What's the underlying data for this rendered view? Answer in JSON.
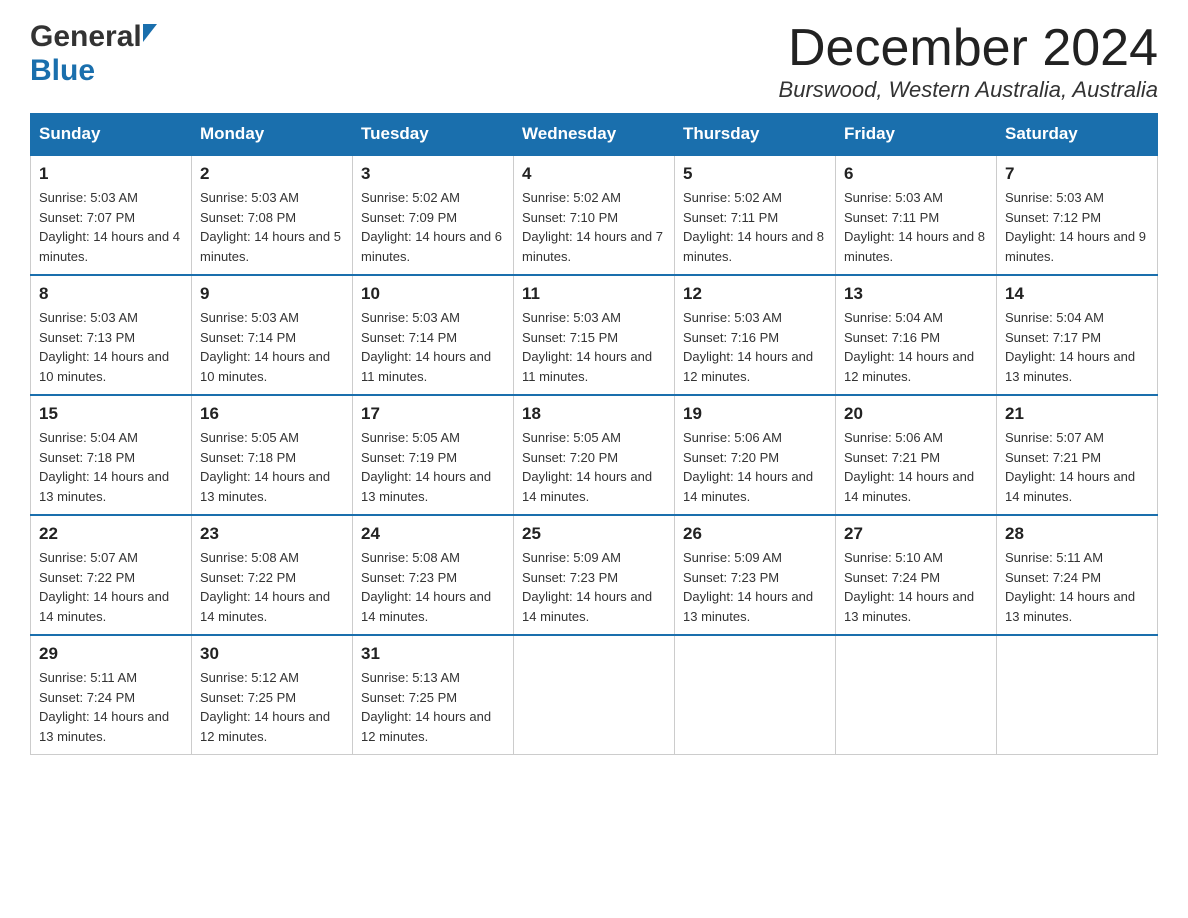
{
  "logo": {
    "general": "General",
    "blue": "Blue"
  },
  "header": {
    "title": "December 2024",
    "location": "Burswood, Western Australia, Australia"
  },
  "days_of_week": [
    "Sunday",
    "Monday",
    "Tuesday",
    "Wednesday",
    "Thursday",
    "Friday",
    "Saturday"
  ],
  "weeks": [
    [
      {
        "date": "1",
        "sunrise": "Sunrise: 5:03 AM",
        "sunset": "Sunset: 7:07 PM",
        "daylight": "Daylight: 14 hours and 4 minutes."
      },
      {
        "date": "2",
        "sunrise": "Sunrise: 5:03 AM",
        "sunset": "Sunset: 7:08 PM",
        "daylight": "Daylight: 14 hours and 5 minutes."
      },
      {
        "date": "3",
        "sunrise": "Sunrise: 5:02 AM",
        "sunset": "Sunset: 7:09 PM",
        "daylight": "Daylight: 14 hours and 6 minutes."
      },
      {
        "date": "4",
        "sunrise": "Sunrise: 5:02 AM",
        "sunset": "Sunset: 7:10 PM",
        "daylight": "Daylight: 14 hours and 7 minutes."
      },
      {
        "date": "5",
        "sunrise": "Sunrise: 5:02 AM",
        "sunset": "Sunset: 7:11 PM",
        "daylight": "Daylight: 14 hours and 8 minutes."
      },
      {
        "date": "6",
        "sunrise": "Sunrise: 5:03 AM",
        "sunset": "Sunset: 7:11 PM",
        "daylight": "Daylight: 14 hours and 8 minutes."
      },
      {
        "date": "7",
        "sunrise": "Sunrise: 5:03 AM",
        "sunset": "Sunset: 7:12 PM",
        "daylight": "Daylight: 14 hours and 9 minutes."
      }
    ],
    [
      {
        "date": "8",
        "sunrise": "Sunrise: 5:03 AM",
        "sunset": "Sunset: 7:13 PM",
        "daylight": "Daylight: 14 hours and 10 minutes."
      },
      {
        "date": "9",
        "sunrise": "Sunrise: 5:03 AM",
        "sunset": "Sunset: 7:14 PM",
        "daylight": "Daylight: 14 hours and 10 minutes."
      },
      {
        "date": "10",
        "sunrise": "Sunrise: 5:03 AM",
        "sunset": "Sunset: 7:14 PM",
        "daylight": "Daylight: 14 hours and 11 minutes."
      },
      {
        "date": "11",
        "sunrise": "Sunrise: 5:03 AM",
        "sunset": "Sunset: 7:15 PM",
        "daylight": "Daylight: 14 hours and 11 minutes."
      },
      {
        "date": "12",
        "sunrise": "Sunrise: 5:03 AM",
        "sunset": "Sunset: 7:16 PM",
        "daylight": "Daylight: 14 hours and 12 minutes."
      },
      {
        "date": "13",
        "sunrise": "Sunrise: 5:04 AM",
        "sunset": "Sunset: 7:16 PM",
        "daylight": "Daylight: 14 hours and 12 minutes."
      },
      {
        "date": "14",
        "sunrise": "Sunrise: 5:04 AM",
        "sunset": "Sunset: 7:17 PM",
        "daylight": "Daylight: 14 hours and 13 minutes."
      }
    ],
    [
      {
        "date": "15",
        "sunrise": "Sunrise: 5:04 AM",
        "sunset": "Sunset: 7:18 PM",
        "daylight": "Daylight: 14 hours and 13 minutes."
      },
      {
        "date": "16",
        "sunrise": "Sunrise: 5:05 AM",
        "sunset": "Sunset: 7:18 PM",
        "daylight": "Daylight: 14 hours and 13 minutes."
      },
      {
        "date": "17",
        "sunrise": "Sunrise: 5:05 AM",
        "sunset": "Sunset: 7:19 PM",
        "daylight": "Daylight: 14 hours and 13 minutes."
      },
      {
        "date": "18",
        "sunrise": "Sunrise: 5:05 AM",
        "sunset": "Sunset: 7:20 PM",
        "daylight": "Daylight: 14 hours and 14 minutes."
      },
      {
        "date": "19",
        "sunrise": "Sunrise: 5:06 AM",
        "sunset": "Sunset: 7:20 PM",
        "daylight": "Daylight: 14 hours and 14 minutes."
      },
      {
        "date": "20",
        "sunrise": "Sunrise: 5:06 AM",
        "sunset": "Sunset: 7:21 PM",
        "daylight": "Daylight: 14 hours and 14 minutes."
      },
      {
        "date": "21",
        "sunrise": "Sunrise: 5:07 AM",
        "sunset": "Sunset: 7:21 PM",
        "daylight": "Daylight: 14 hours and 14 minutes."
      }
    ],
    [
      {
        "date": "22",
        "sunrise": "Sunrise: 5:07 AM",
        "sunset": "Sunset: 7:22 PM",
        "daylight": "Daylight: 14 hours and 14 minutes."
      },
      {
        "date": "23",
        "sunrise": "Sunrise: 5:08 AM",
        "sunset": "Sunset: 7:22 PM",
        "daylight": "Daylight: 14 hours and 14 minutes."
      },
      {
        "date": "24",
        "sunrise": "Sunrise: 5:08 AM",
        "sunset": "Sunset: 7:23 PM",
        "daylight": "Daylight: 14 hours and 14 minutes."
      },
      {
        "date": "25",
        "sunrise": "Sunrise: 5:09 AM",
        "sunset": "Sunset: 7:23 PM",
        "daylight": "Daylight: 14 hours and 14 minutes."
      },
      {
        "date": "26",
        "sunrise": "Sunrise: 5:09 AM",
        "sunset": "Sunset: 7:23 PM",
        "daylight": "Daylight: 14 hours and 13 minutes."
      },
      {
        "date": "27",
        "sunrise": "Sunrise: 5:10 AM",
        "sunset": "Sunset: 7:24 PM",
        "daylight": "Daylight: 14 hours and 13 minutes."
      },
      {
        "date": "28",
        "sunrise": "Sunrise: 5:11 AM",
        "sunset": "Sunset: 7:24 PM",
        "daylight": "Daylight: 14 hours and 13 minutes."
      }
    ],
    [
      {
        "date": "29",
        "sunrise": "Sunrise: 5:11 AM",
        "sunset": "Sunset: 7:24 PM",
        "daylight": "Daylight: 14 hours and 13 minutes."
      },
      {
        "date": "30",
        "sunrise": "Sunrise: 5:12 AM",
        "sunset": "Sunset: 7:25 PM",
        "daylight": "Daylight: 14 hours and 12 minutes."
      },
      {
        "date": "31",
        "sunrise": "Sunrise: 5:13 AM",
        "sunset": "Sunset: 7:25 PM",
        "daylight": "Daylight: 14 hours and 12 minutes."
      },
      null,
      null,
      null,
      null
    ]
  ]
}
